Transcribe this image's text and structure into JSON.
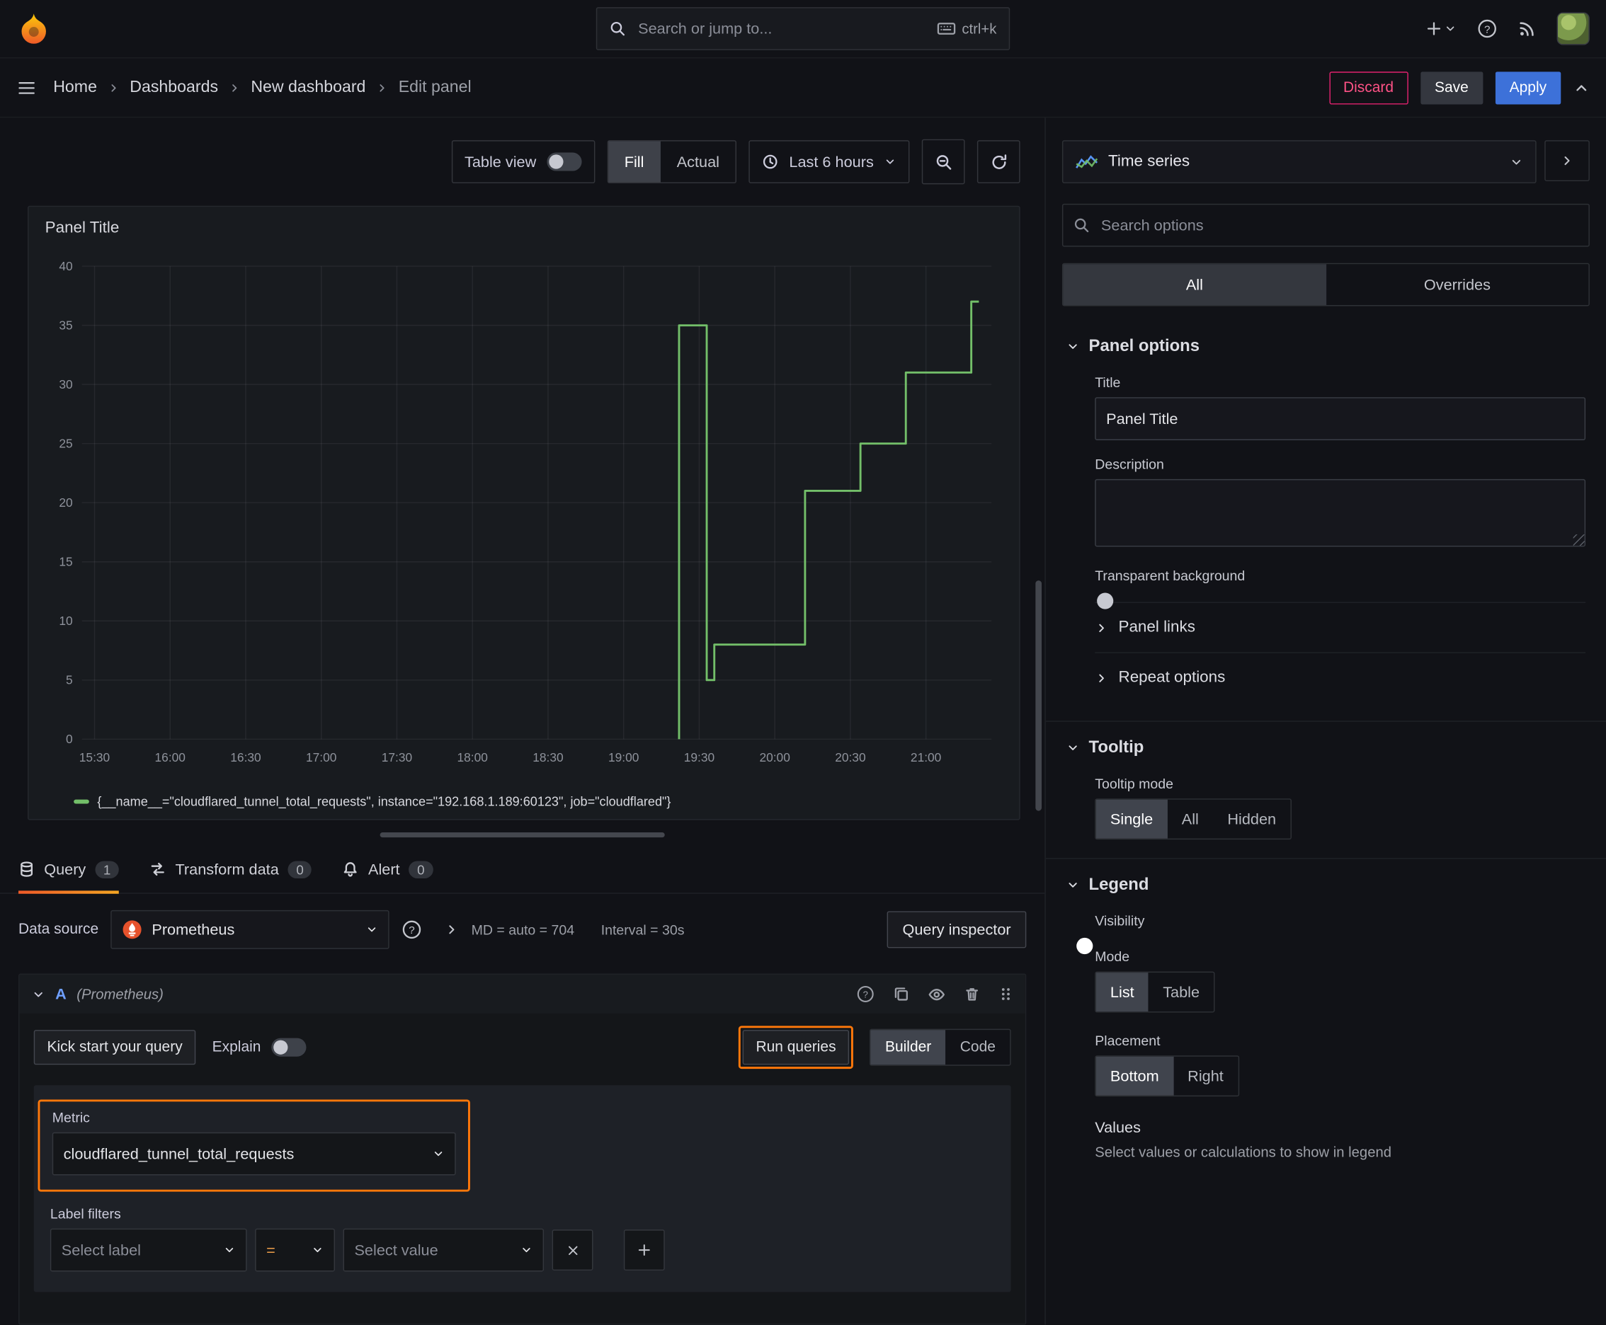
{
  "topnav": {
    "search_placeholder": "Search or jump to...",
    "search_shortcut": "ctrl+k"
  },
  "breadcrumb": {
    "items": [
      "Home",
      "Dashboards",
      "New dashboard",
      "Edit panel"
    ],
    "discard_label": "Discard",
    "save_label": "Save",
    "apply_label": "Apply"
  },
  "panel_toolbar": {
    "table_view_label": "Table view",
    "fill_label": "Fill",
    "actual_label": "Actual",
    "time_range_label": "Last 6 hours"
  },
  "panel": {
    "title": "Panel Title"
  },
  "chart_data": {
    "type": "line",
    "title": "Panel Title",
    "x_ticks": [
      "15:30",
      "16:00",
      "16:30",
      "17:00",
      "17:30",
      "18:00",
      "18:30",
      "19:00",
      "19:30",
      "20:00",
      "20:30",
      "21:00"
    ],
    "x_range_minutes": [
      "15:25",
      "21:26"
    ],
    "ylim": [
      0,
      40
    ],
    "y_ticks": [
      0,
      5,
      10,
      15,
      20,
      25,
      30,
      35,
      40
    ],
    "grid": true,
    "legend_position": "bottom",
    "series": [
      {
        "name": "{__name__=\"cloudflared_tunnel_total_requests\", instance=\"192.168.1.189:60123\", job=\"cloudflared\"}",
        "color": "#73bf69",
        "points": [
          {
            "t": "19:22",
            "v": 0
          },
          {
            "t": "19:22",
            "v": 35
          },
          {
            "t": "19:33",
            "v": 35
          },
          {
            "t": "19:33",
            "v": 5
          },
          {
            "t": "19:36",
            "v": 5
          },
          {
            "t": "19:36",
            "v": 8
          },
          {
            "t": "20:12",
            "v": 8
          },
          {
            "t": "20:12",
            "v": 21
          },
          {
            "t": "20:34",
            "v": 21
          },
          {
            "t": "20:34",
            "v": 25
          },
          {
            "t": "20:52",
            "v": 25
          },
          {
            "t": "20:52",
            "v": 31
          },
          {
            "t": "21:18",
            "v": 31
          },
          {
            "t": "21:18",
            "v": 37
          },
          {
            "t": "21:21",
            "v": 37
          }
        ]
      }
    ]
  },
  "editor_tabs": {
    "query_label": "Query",
    "query_count": "1",
    "transform_label": "Transform data",
    "transform_count": "0",
    "alert_label": "Alert",
    "alert_count": "0"
  },
  "query_editor": {
    "datasource_label": "Data source",
    "datasource_value": "Prometheus",
    "max_data_points": "MD = auto = 704",
    "interval": "Interval = 30s",
    "query_inspector_label": "Query inspector",
    "row_ref": "A",
    "row_datasource": "(Prometheus)",
    "kick_start_label": "Kick start your query",
    "explain_label": "Explain",
    "run_queries_label": "Run queries",
    "builder_label": "Builder",
    "code_label": "Code",
    "metric_label": "Metric",
    "metric_value": "cloudflared_tunnel_total_requests",
    "label_filters_label": "Label filters",
    "select_label_placeholder": "Select label",
    "operator_value": "=",
    "select_value_placeholder": "Select value"
  },
  "options_sidebar": {
    "viz_type": "Time series",
    "search_placeholder": "Search options",
    "tab_all": "All",
    "tab_overrides": "Overrides",
    "panel_options": {
      "header": "Panel options",
      "title_label": "Title",
      "title_value": "Panel Title",
      "description_label": "Description",
      "transparent_label": "Transparent background",
      "links_label": "Panel links",
      "repeat_label": "Repeat options"
    },
    "tooltip": {
      "header": "Tooltip",
      "mode_label": "Tooltip mode",
      "modes": [
        "Single",
        "All",
        "Hidden"
      ]
    },
    "legend": {
      "header": "Legend",
      "visibility_label": "Visibility",
      "mode_label": "Mode",
      "modes": [
        "List",
        "Table"
      ],
      "placement_label": "Placement",
      "placements": [
        "Bottom",
        "Right"
      ],
      "values_label": "Values",
      "values_description": "Select values or calculations to show in legend"
    }
  },
  "colors": {
    "accent_orange": "#ff780a",
    "primary_blue": "#3d71d9",
    "destructive_red": "#ff5286",
    "series_green": "#73bf69"
  }
}
